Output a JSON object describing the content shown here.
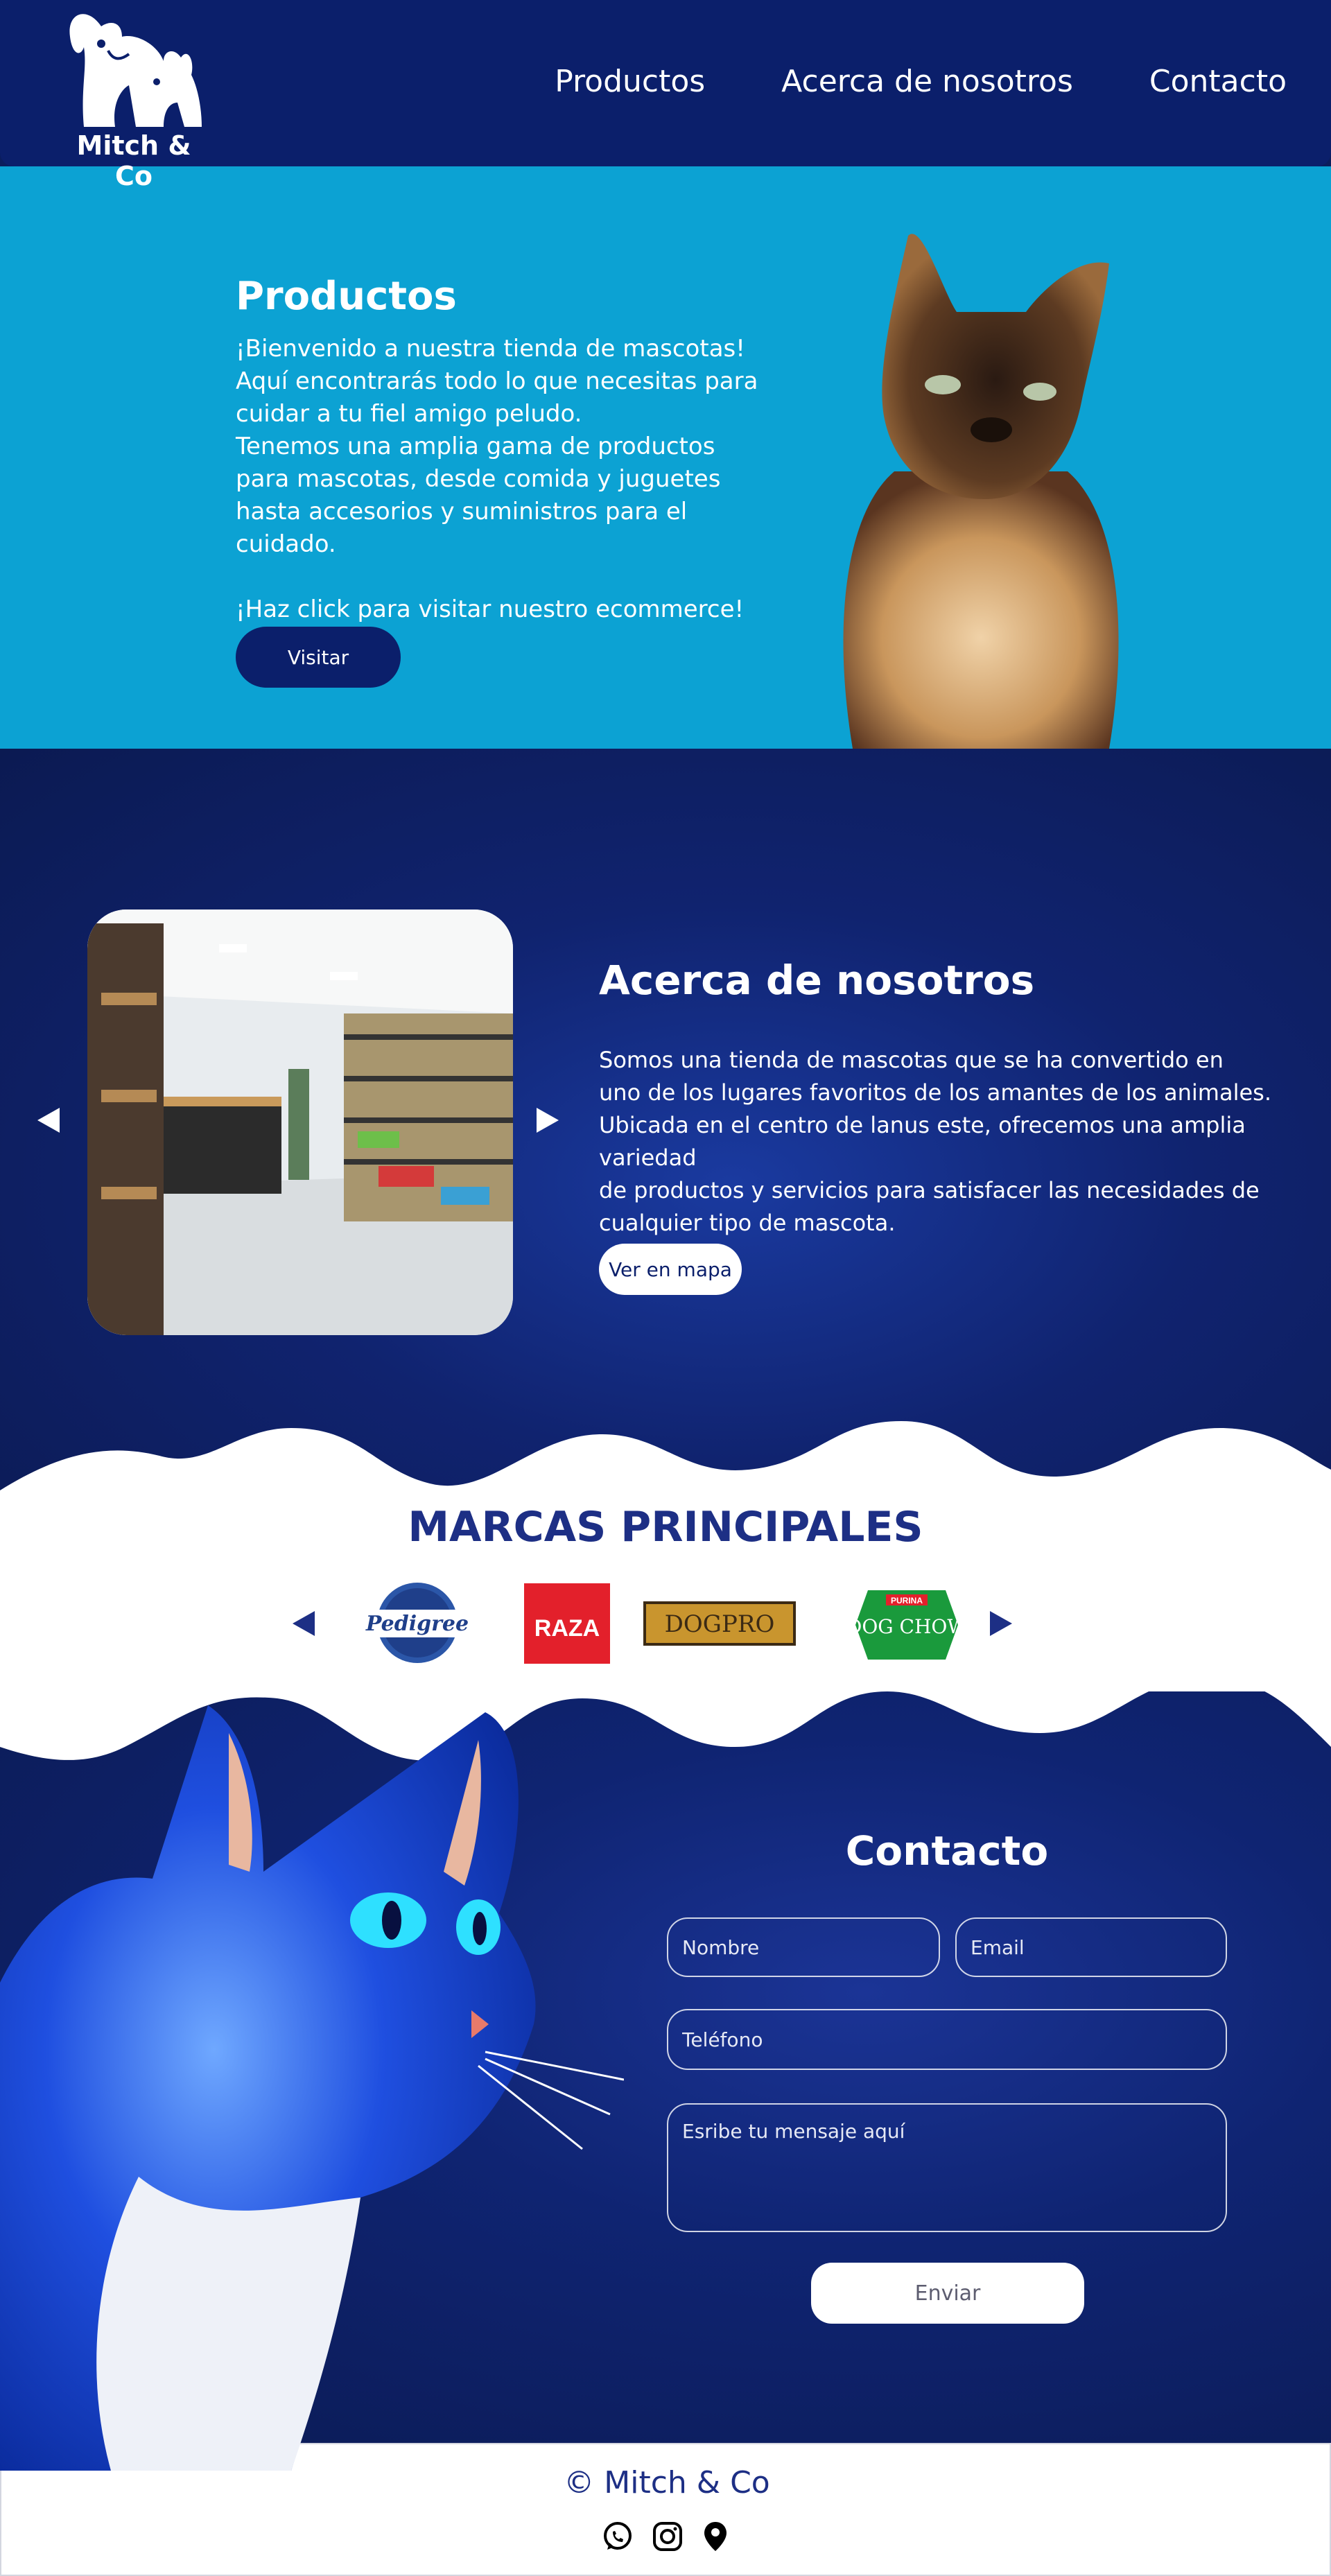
{
  "header": {
    "logo_text": "Mitch & Co",
    "nav": [
      "Productos",
      "Acerca de nosotros",
      "Contacto"
    ]
  },
  "hero": {
    "title": "Productos",
    "text": "¡Bienvenido a nuestra tienda de mascotas!\nAquí encontrarás todo lo que necesitas para\ncuidar a tu fiel amigo peludo.\nTenemos una amplia gama de productos\npara mascotas, desde comida y juguetes\nhasta accesorios y suministros para el cuidado.\n\n¡Haz click para visitar nuestro ecommerce!",
    "button": "Visitar"
  },
  "about": {
    "title": "Acerca de nosotros",
    "text": "Somos una tienda de mascotas que se ha convertido en\nuno de los lugares favoritos de los amantes de los animales.\nUbicada en el centro de lanus este, ofrecemos una amplia variedad\nde productos y servicios para satisfacer las necesidades de\ncualquier tipo de mascota.",
    "button": "Ver en mapa"
  },
  "brands": {
    "title": "MARCAS PRINCIPALES",
    "items": [
      "Pedigree",
      "RAZA",
      "DOGPRO",
      "PURINA",
      "DOG CHOW"
    ]
  },
  "contact": {
    "title": "Contacto",
    "name_placeholder": "Nombre",
    "email_placeholder": "Email",
    "phone_placeholder": "Teléfono",
    "message_placeholder": "Esribe tu mensaje aquí",
    "send": "Enviar"
  },
  "footer": {
    "copyright": "© Mitch & Co",
    "icons": [
      "whatsapp-icon",
      "instagram-icon",
      "location-pin-icon"
    ]
  },
  "colors": {
    "navy": "#0b1f6b",
    "hero_blue": "#0ca2d3",
    "brand_title": "#1d2f85"
  }
}
